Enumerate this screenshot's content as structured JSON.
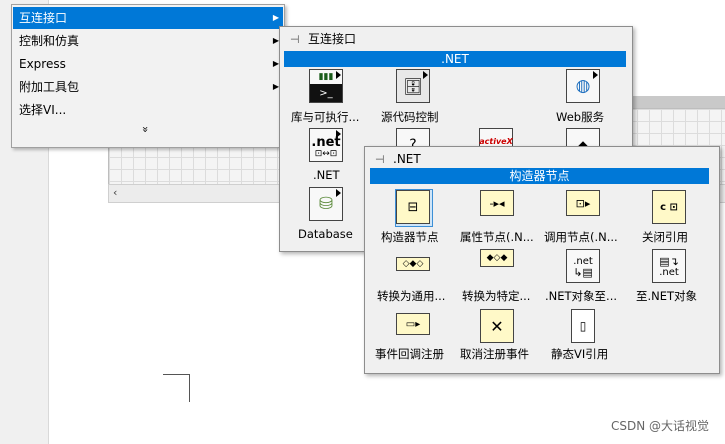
{
  "menu": {
    "items": [
      {
        "label": "互连接口"
      },
      {
        "label": "控制和仿真"
      },
      {
        "label": "Express"
      },
      {
        "label": "附加工具包"
      },
      {
        "label": "选择VI..."
      }
    ],
    "more_glyph": "»"
  },
  "palette1": {
    "title": "互连接口",
    "category": ".NET",
    "items": [
      {
        "label": "库与可执行..."
      },
      {
        "label": "源代码控制"
      },
      {
        "label": "Web服务"
      },
      {
        "label": ".NET"
      },
      {
        "label": "Database"
      }
    ],
    "icon_text": {
      "net": ".net",
      "activex": "activeX",
      "cmd": ">_"
    }
  },
  "palette2": {
    "title": ".NET",
    "category": "构造器节点",
    "items": [
      {
        "label": "构造器节点"
      },
      {
        "label": "属性节点(.N..."
      },
      {
        "label": "调用节点(.N..."
      },
      {
        "label": "关闭引用"
      },
      {
        "label": "转换为通用..."
      },
      {
        "label": "转换为特定..."
      },
      {
        "label": ".NET对象至..."
      },
      {
        "label": "至.NET对象"
      },
      {
        "label": "事件回调注册"
      },
      {
        "label": "取消注册事件"
      },
      {
        "label": "静态VI引用"
      }
    ],
    "icon_text": {
      "net": ".net",
      "close": "c ⊡"
    }
  },
  "watermark": "CSDN @大话视觉",
  "colors": {
    "highlight": "#0078d7",
    "icon_yellow": "#fff9c8"
  }
}
